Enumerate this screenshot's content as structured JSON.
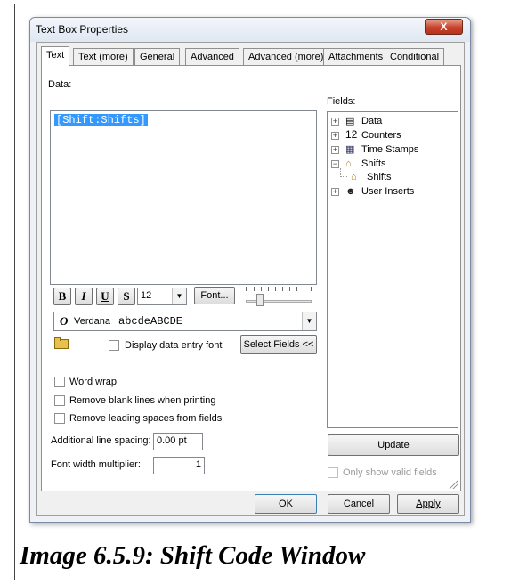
{
  "window": {
    "title": "Text Box Properties",
    "close_glyph": "X"
  },
  "tabs": [
    "Text",
    "Text (more)",
    "General",
    "Advanced",
    "Advanced (more)",
    "Attachments",
    "Conditional"
  ],
  "data_label": "Data:",
  "data_value": "[Shift:Shifts]",
  "fields_label": "Fields:",
  "fields_tree": [
    {
      "label": "Data",
      "icon": "data-icon",
      "expander": "⊞"
    },
    {
      "label": "Counters",
      "icon": "counters-icon",
      "expander": "⊞",
      "icon_text": "12"
    },
    {
      "label": "Time Stamps",
      "icon": "calendar-icon",
      "expander": "⊞"
    },
    {
      "label": "Shifts",
      "icon": "shift-icon",
      "expander": "⊟"
    },
    {
      "label": "Shifts",
      "icon": "shift-icon",
      "expander": ""
    },
    {
      "label": "User Inserts",
      "icon": "user-icon",
      "expander": "⊞"
    }
  ],
  "format": {
    "bold": "B",
    "italic": "I",
    "underline": "U",
    "strike": "S",
    "font_size": "12",
    "font_button": "Font...",
    "font_name": "Verdana",
    "font_sample": "abcdeABCDE",
    "font_type_glyph": "O"
  },
  "display_entry_font_label": "Display data entry font",
  "select_fields_button": "Select Fields <<",
  "options": {
    "word_wrap": "Word wrap",
    "remove_blank": "Remove blank lines when printing",
    "remove_leading": "Remove leading spaces from fields"
  },
  "line_spacing_label": "Additional line spacing:",
  "line_spacing_value": "0.00 pt",
  "width_mult_label": "Font width multiplier:",
  "width_mult_value": "1",
  "update_button": "Update",
  "only_valid_label": "Only show valid fields",
  "footer": {
    "ok": "OK",
    "cancel": "Cancel",
    "apply": "Apply"
  },
  "caption": "Image 6.5.9: Shift Code Window"
}
